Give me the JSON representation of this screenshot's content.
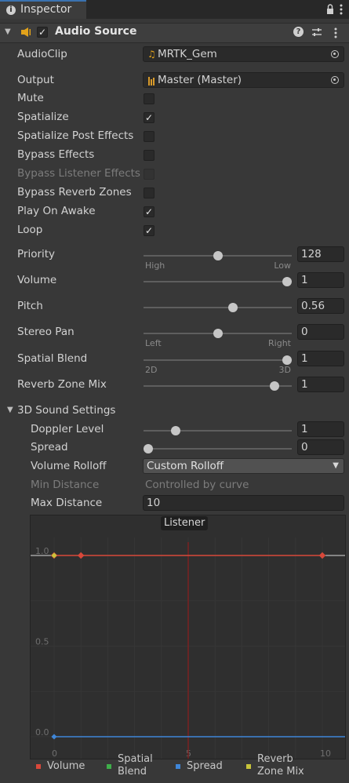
{
  "tab": {
    "title": "Inspector"
  },
  "component": {
    "name": "Audio Source",
    "enabled": true
  },
  "fields": {
    "audio_clip": {
      "label": "AudioClip",
      "value": "MRTK_Gem"
    },
    "output": {
      "label": "Output",
      "value": "Master (Master)"
    }
  },
  "toggles": [
    {
      "label": "Mute",
      "checked": false,
      "disabled": false
    },
    {
      "label": "Spatialize",
      "checked": true,
      "disabled": false
    },
    {
      "label": "Spatialize Post Effects",
      "checked": false,
      "disabled": false
    },
    {
      "label": "Bypass Effects",
      "checked": false,
      "disabled": false
    },
    {
      "label": "Bypass Listener Effects",
      "checked": false,
      "disabled": true
    },
    {
      "label": "Bypass Reverb Zones",
      "checked": false,
      "disabled": false
    },
    {
      "label": "Play On Awake",
      "checked": true,
      "disabled": false
    },
    {
      "label": "Loop",
      "checked": true,
      "disabled": false
    }
  ],
  "sliders": {
    "priority": {
      "label": "Priority",
      "value": "128",
      "fraction": 0.5,
      "min_label": "High",
      "max_label": "Low"
    },
    "volume": {
      "label": "Volume",
      "value": "1",
      "fraction": 1.0
    },
    "pitch": {
      "label": "Pitch",
      "value": "0.56",
      "fraction": 0.61
    },
    "stereo_pan": {
      "label": "Stereo Pan",
      "value": "0",
      "fraction": 0.5,
      "min_label": "Left",
      "max_label": "Right"
    },
    "spatial_blend": {
      "label": "Spatial Blend",
      "value": "1",
      "fraction": 1.0,
      "min_label": "2D",
      "max_label": "3D"
    },
    "reverb_zone_mix": {
      "label": "Reverb Zone Mix",
      "value": "1",
      "fraction": 0.91
    }
  },
  "sound3d": {
    "title": "3D Sound Settings",
    "doppler": {
      "label": "Doppler Level",
      "value": "1",
      "fraction": 0.2
    },
    "spread": {
      "label": "Spread",
      "value": "0",
      "fraction": 0.0
    },
    "rolloff": {
      "label": "Volume Rolloff",
      "value": "Custom Rolloff"
    },
    "min_distance": {
      "label": "Min Distance",
      "value": "Controlled by curve"
    },
    "max_distance": {
      "label": "Max Distance",
      "value": "10"
    }
  },
  "graph": {
    "listener_label": "Listener",
    "y_ticks": [
      "1.0",
      "0.5",
      "0.0"
    ],
    "x_ticks": [
      "0",
      "5",
      "10"
    ],
    "legend": [
      {
        "label": "Volume",
        "color": "#d8483a"
      },
      {
        "label": "Spatial Blend",
        "color": "#3fae4a"
      },
      {
        "label": "Spread",
        "color": "#3f86d8"
      },
      {
        "label": "Reverb Zone Mix",
        "color": "#c8c43a"
      }
    ],
    "colors": {
      "listener_line": "#7a2020",
      "volume": "#d8483a",
      "spread": "#3f86d8",
      "reverb": "#c8c43a"
    }
  }
}
